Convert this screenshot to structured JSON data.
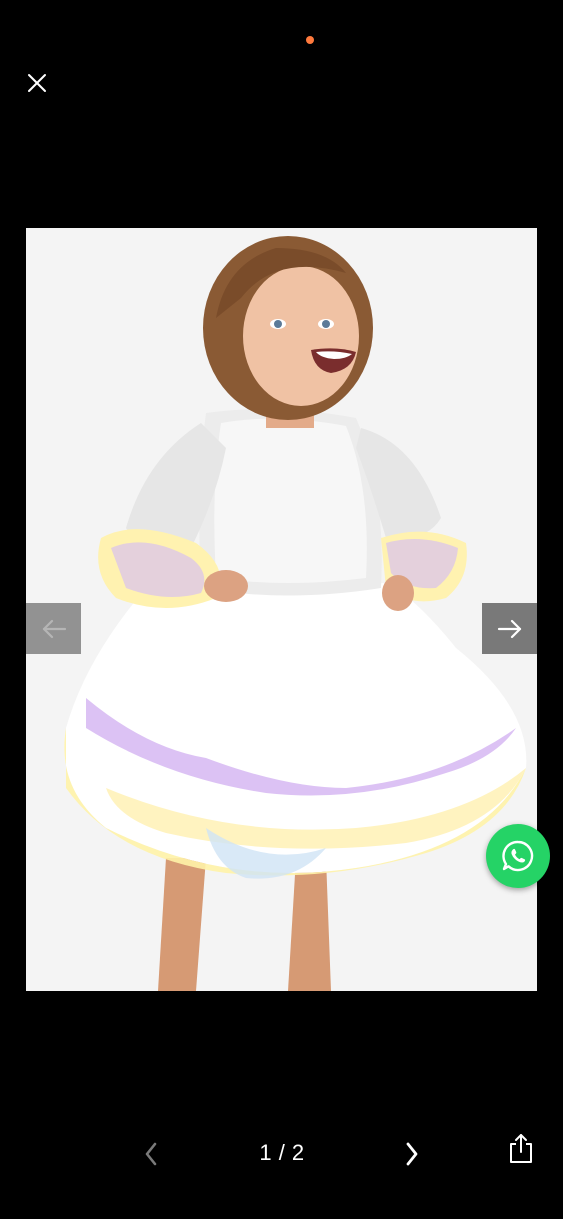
{
  "colors": {
    "background": "#000000",
    "indicator": "#ff7a3d",
    "whatsapp": "#25d366",
    "nav_disabled_arrow": "#b5b5b5",
    "nav_enabled_arrow": "#ffffff",
    "pager_disabled": "#7a7a7a"
  },
  "icons": {
    "close": "close-icon",
    "prev": "arrow-left-icon",
    "next": "arrow-right-icon",
    "whatsapp": "whatsapp-icon",
    "pager_prev": "chevron-left-icon",
    "pager_next": "chevron-right-icon",
    "share": "share-icon"
  },
  "pager": {
    "current": 1,
    "total": 2,
    "label": "1 / 2"
  }
}
